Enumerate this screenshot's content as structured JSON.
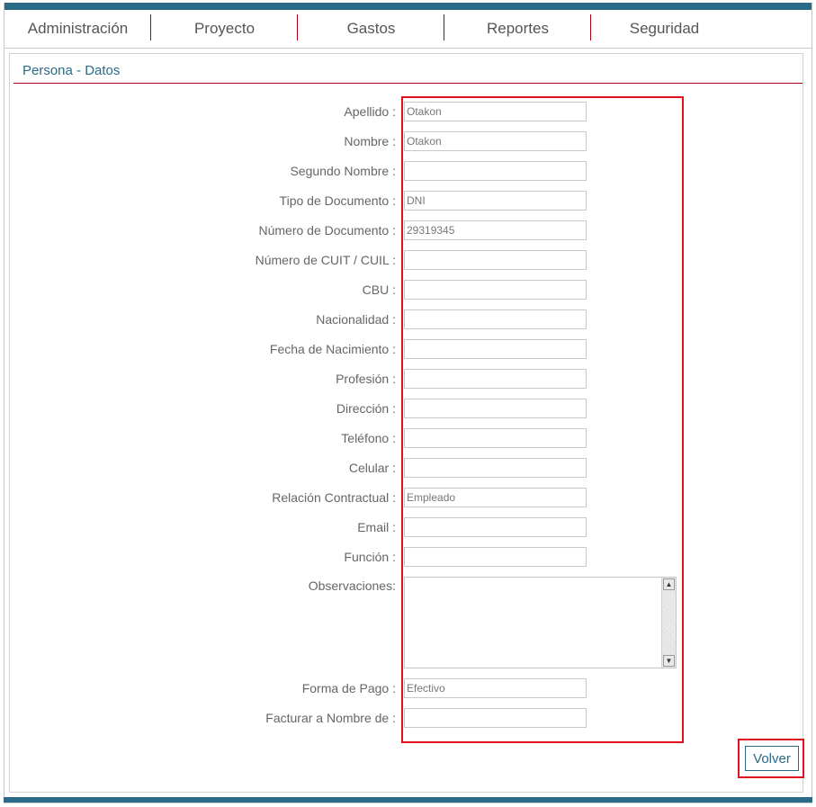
{
  "nav": {
    "items": [
      {
        "label": "Administración"
      },
      {
        "label": "Proyecto"
      },
      {
        "label": "Gastos"
      },
      {
        "label": "Reportes"
      },
      {
        "label": "Seguridad"
      }
    ]
  },
  "panel": {
    "title": "Persona - Datos"
  },
  "form": {
    "fields": [
      {
        "label": "Apellido :",
        "value": "Otakon"
      },
      {
        "label": "Nombre :",
        "value": "Otakon"
      },
      {
        "label": "Segundo Nombre :",
        "value": ""
      },
      {
        "label": "Tipo de Documento :",
        "value": "DNI"
      },
      {
        "label": "Número de Documento :",
        "value": "29319345"
      },
      {
        "label": "Número de CUIT / CUIL :",
        "value": ""
      },
      {
        "label": "CBU :",
        "value": ""
      },
      {
        "label": "Nacionalidad :",
        "value": ""
      },
      {
        "label": "Fecha de Nacimiento :",
        "value": ""
      },
      {
        "label": "Profesión :",
        "value": ""
      },
      {
        "label": "Dirección :",
        "value": ""
      },
      {
        "label": "Teléfono :",
        "value": ""
      },
      {
        "label": "Celular :",
        "value": ""
      },
      {
        "label": "Relación Contractual :",
        "value": "Empleado"
      },
      {
        "label": "Email :",
        "value": ""
      },
      {
        "label": "Función :",
        "value": ""
      }
    ],
    "observaciones": {
      "label": "Observaciones:",
      "value": ""
    },
    "forma_pago": {
      "label": "Forma de Pago :",
      "value": "Efectivo"
    },
    "facturar": {
      "label": "Facturar a Nombre de :",
      "value": ""
    }
  },
  "actions": {
    "volver_label": "Volver"
  },
  "colors": {
    "accent": "#2a6a86",
    "divider": "#b00018",
    "highlight": "#e0101e"
  }
}
